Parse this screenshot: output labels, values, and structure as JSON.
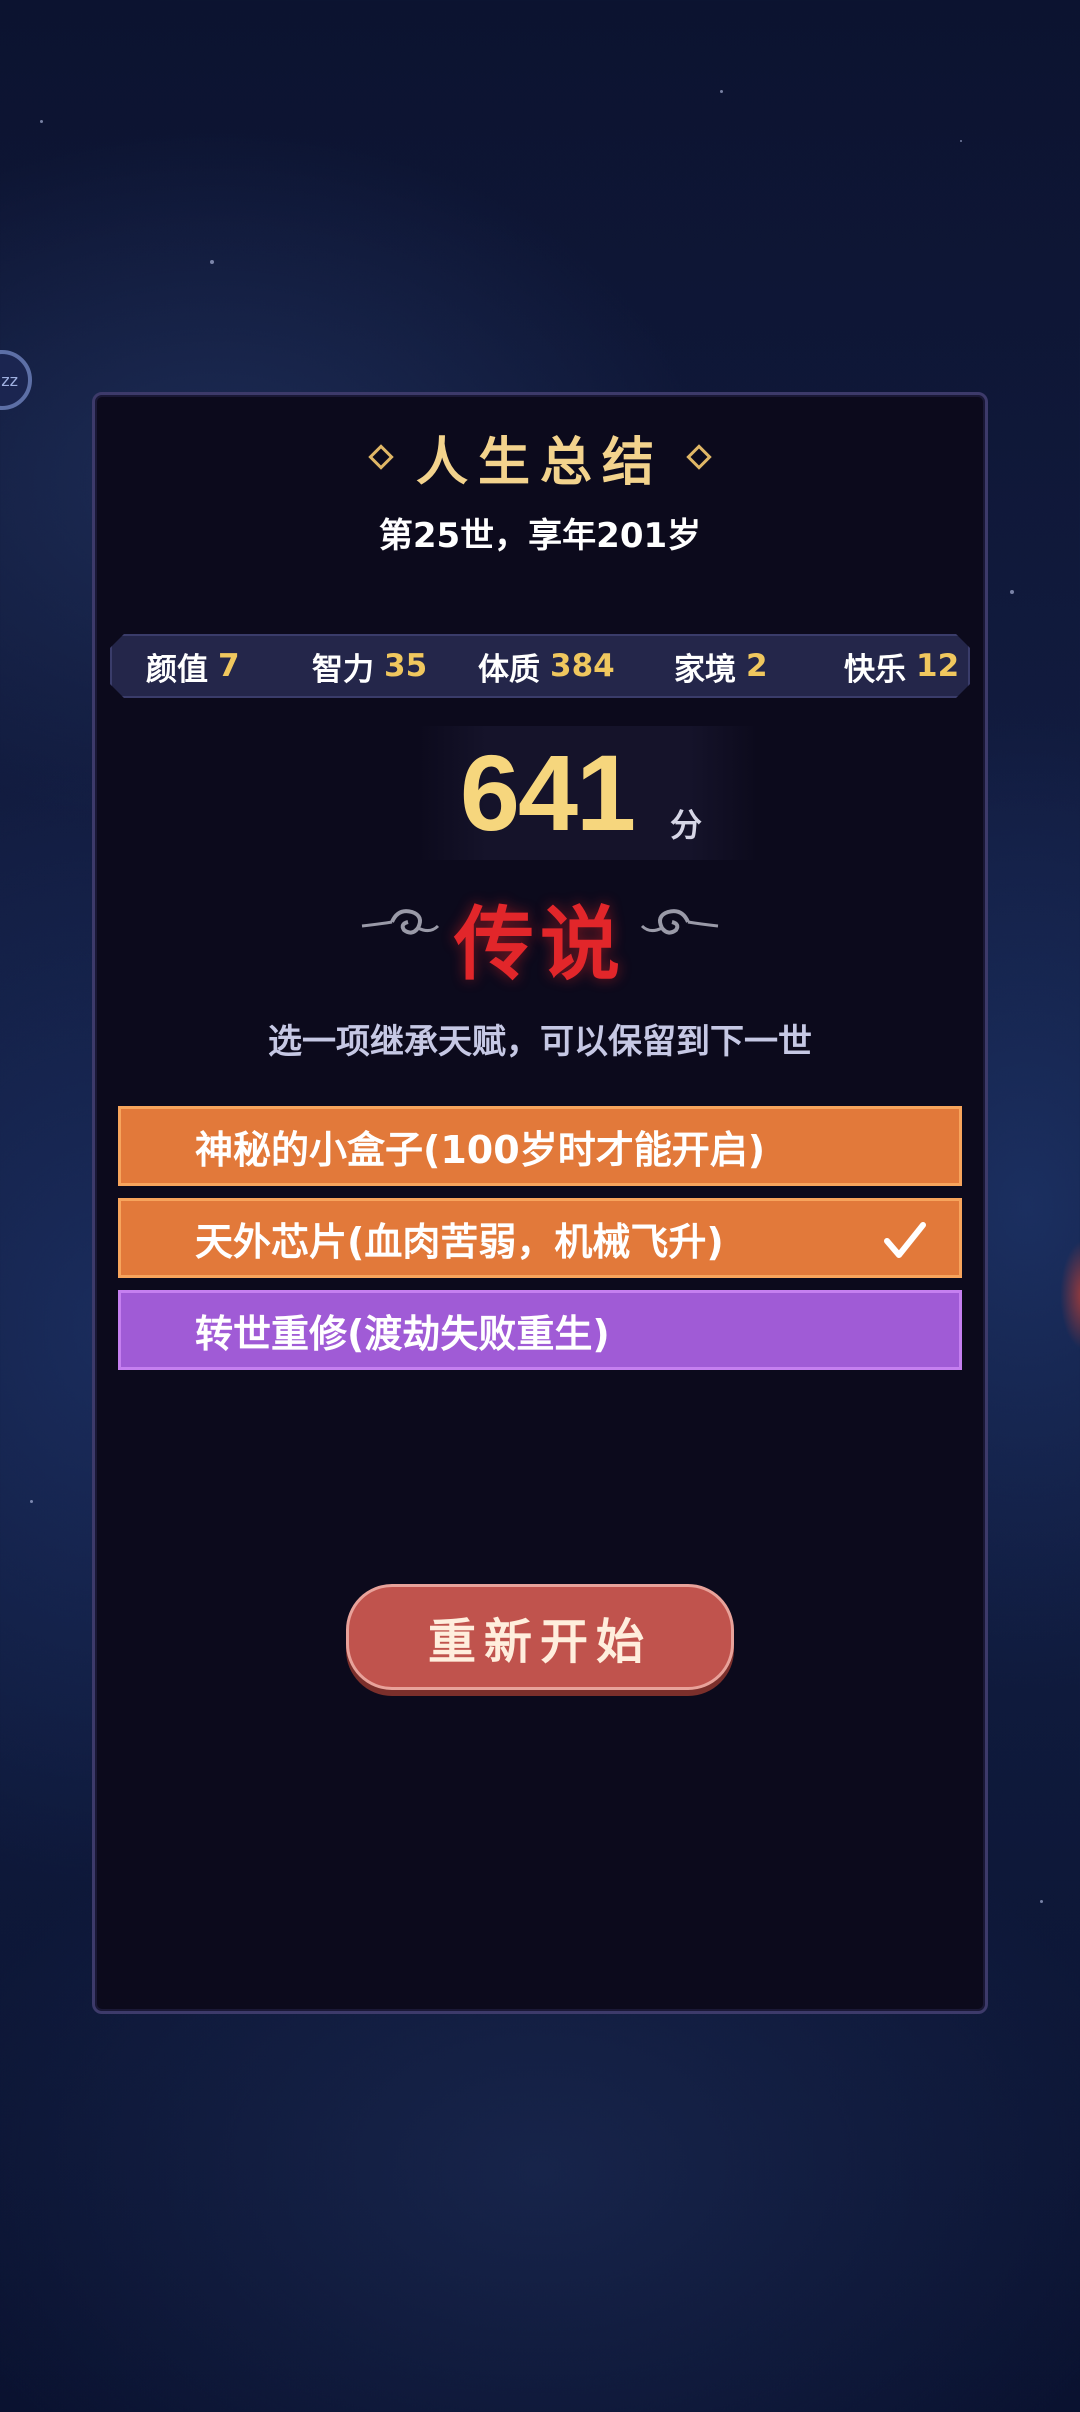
{
  "side_badge": "zz",
  "summary": {
    "title": "人生总结",
    "subtitle": "第25世，享年201岁"
  },
  "stats": [
    {
      "label": "颜值",
      "value": "7"
    },
    {
      "label": "智力",
      "value": "35"
    },
    {
      "label": "体质",
      "value": "384"
    },
    {
      "label": "家境",
      "value": "2"
    },
    {
      "label": "快乐",
      "value": "12"
    }
  ],
  "score": {
    "value": "641",
    "unit": "分"
  },
  "grade": "传说",
  "hint": "选一项继承天赋，可以保留到下一世",
  "options": [
    {
      "label": "神秘的小盒子(100岁时才能开启)",
      "color": "orange",
      "selected": false
    },
    {
      "label": "天外芯片(血肉苦弱，机械飞升)",
      "color": "orange",
      "selected": true
    },
    {
      "label": "转世重修(渡劫失败重生)",
      "color": "purple",
      "selected": false
    }
  ],
  "restart_label": "重新开始",
  "colors": {
    "gold": "#f0c75e",
    "grade_red": "#e2262a",
    "option_orange": "#e2793a",
    "option_purple": "#a05bd6",
    "button_red": "#c0534d"
  }
}
